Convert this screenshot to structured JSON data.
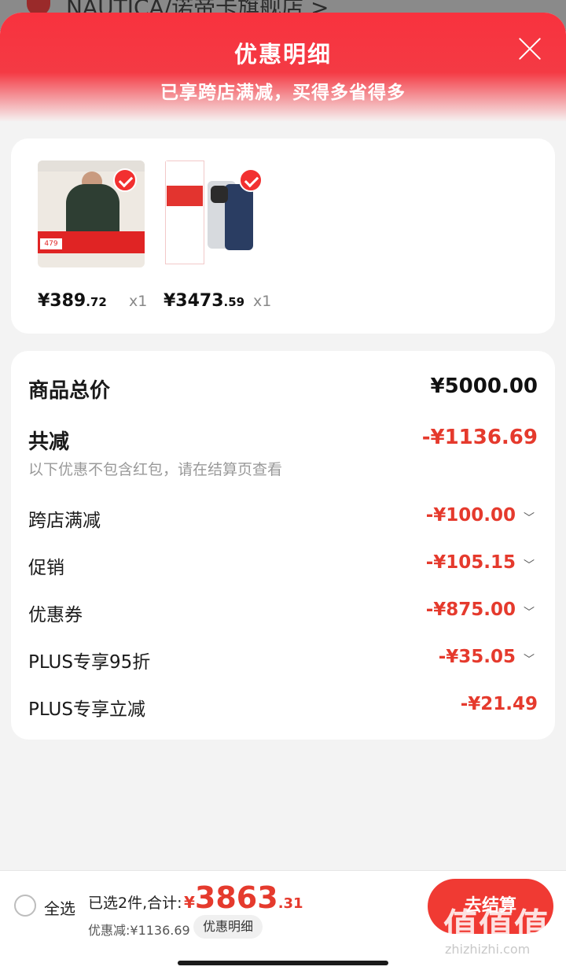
{
  "underlay": {
    "store_name": "NAUTICA/诺帝卡旗舰店 >"
  },
  "header": {
    "title": "优惠明细",
    "subtitle": "已享跨店满减，买得多省得多"
  },
  "products": [
    {
      "price_int": "¥389",
      "price_dec": ".72",
      "qty": "x1",
      "thumb_text": [
        "580元",
        "479",
        "701",
        "105",
        "116"
      ]
    },
    {
      "price_int": "¥3473",
      "price_dec": ".59",
      "qty": "x1",
      "thumb_text": [
        "xiaomi 14",
        "4179"
      ]
    }
  ],
  "summary": {
    "total_label": "商品总价",
    "total_value": "¥5000.00",
    "reduce_label": "共减",
    "reduce_value": "-¥1136.69",
    "note": "以下优惠不包含红包，请在结算页查看",
    "items": [
      {
        "label": "跨店满减",
        "value": "-¥100.00",
        "expandable": true
      },
      {
        "label": "促销",
        "value": "-¥105.15",
        "expandable": true
      },
      {
        "label": "优惠券",
        "value": "-¥875.00",
        "expandable": true
      },
      {
        "label": "PLUS专享95折",
        "value": "-¥35.05",
        "expandable": true
      },
      {
        "label": "PLUS专享立减",
        "value": "-¥21.49",
        "expandable": false
      }
    ]
  },
  "bottom": {
    "select_all": "全选",
    "selected_info": "已选2件,合计:",
    "grand_currency": "¥",
    "grand_int": "3863",
    "grand_dec": ".31",
    "savings": "优惠减:¥1136.69",
    "detail_button": "优惠明细",
    "checkout_button": "去结算",
    "watermark": "值值值",
    "watermark_url": "zhizhizhi.com"
  },
  "colors": {
    "accent": "#f23030",
    "price_red": "#e53a2d"
  }
}
